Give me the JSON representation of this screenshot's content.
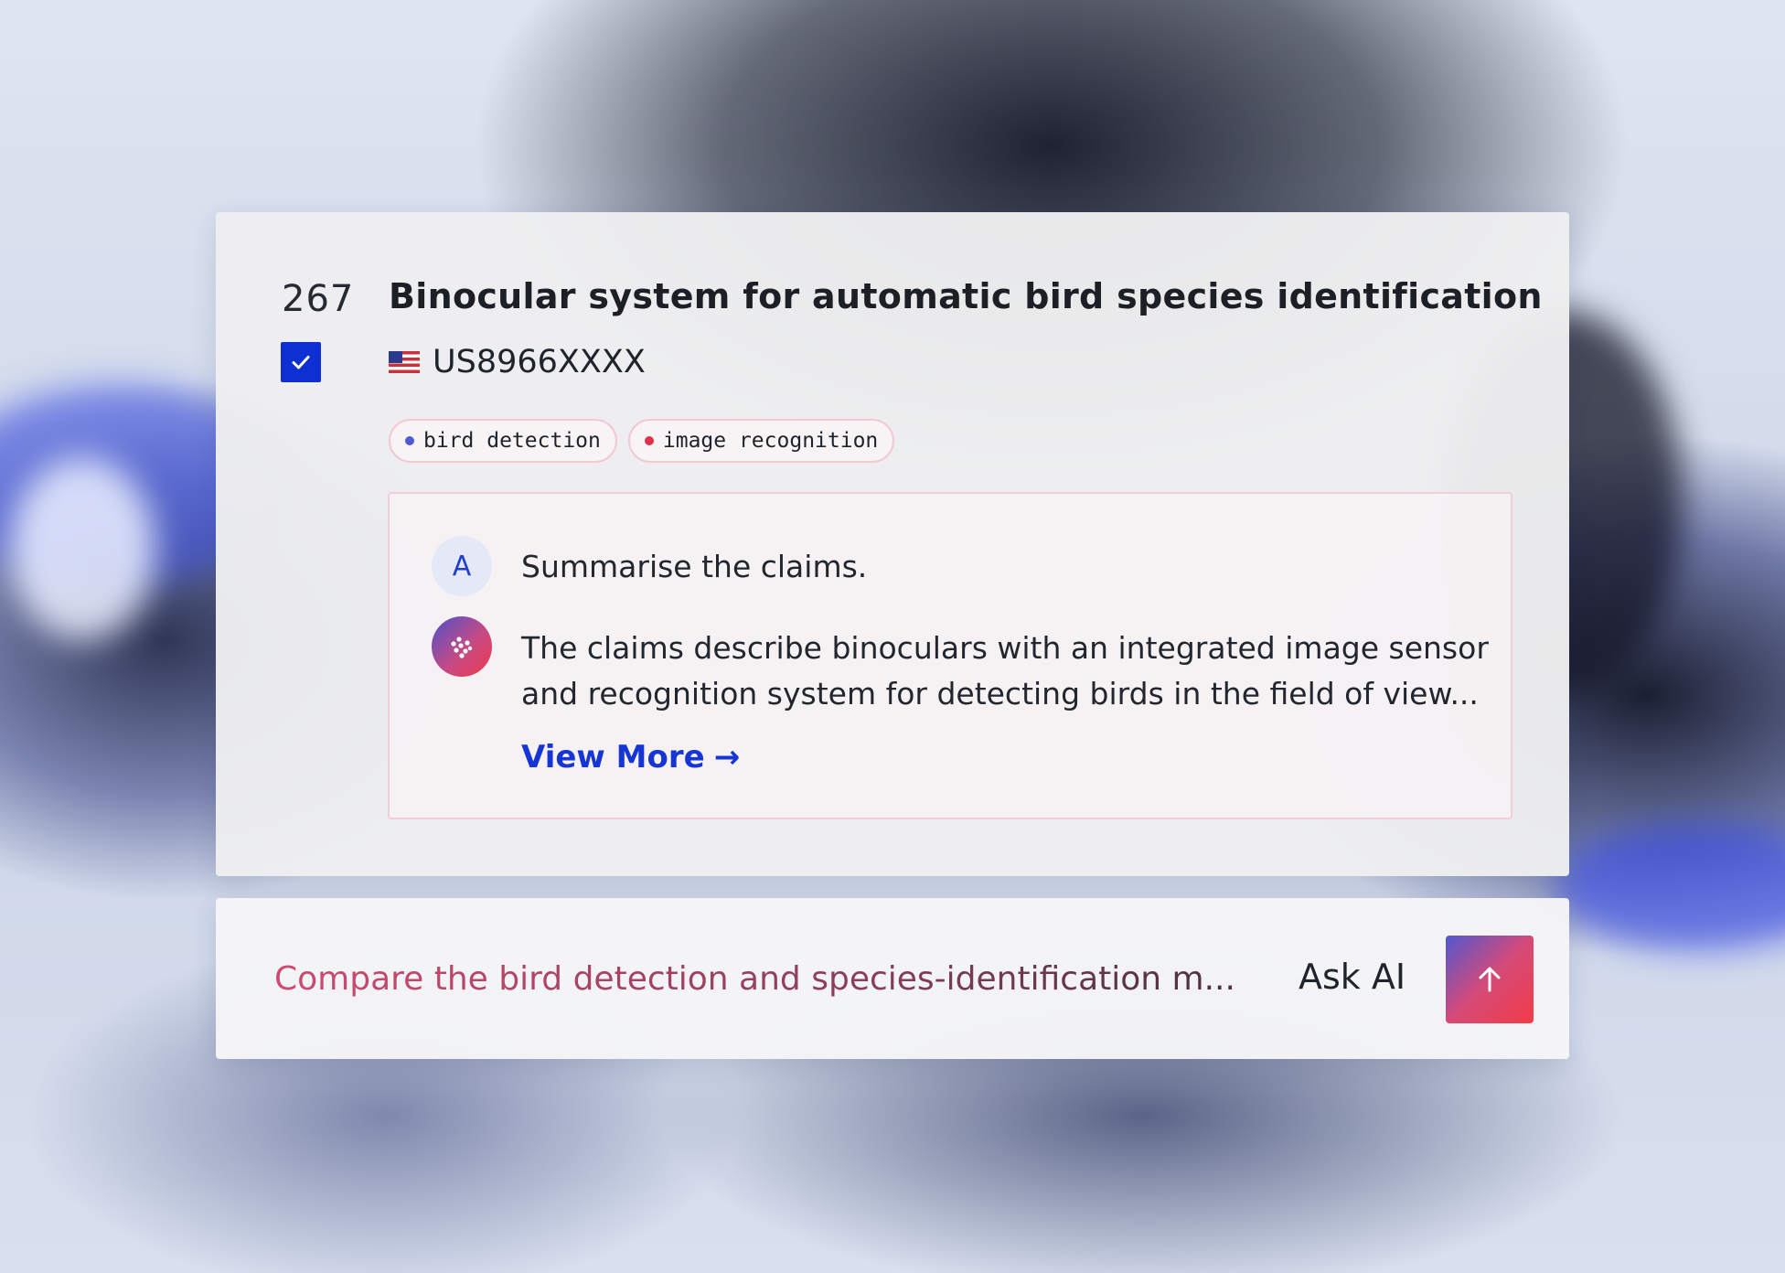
{
  "result": {
    "number": "267",
    "checked": true,
    "title": "Binocular system for automatic bird species identification",
    "patent_id": "US8966XXXX",
    "country_flag": "us-flag-icon"
  },
  "tags": [
    {
      "label": "bird detection",
      "dot_color": "#4f5bd5"
    },
    {
      "label": "image recognition",
      "dot_color": "#e0304a"
    }
  ],
  "chat": {
    "user_initial": "A",
    "question": "Summarise the claims.",
    "answer": "The claims describe binoculars with an integrated image sensor and recognition system for detecting birds in the field of view...",
    "view_more_label": "View More",
    "view_more_arrow": "→"
  },
  "ask_bar": {
    "input_value": "Compare the bird detection and species-identification m...",
    "label": "Ask AI",
    "send_icon": "arrow-up-icon"
  },
  "colors": {
    "accent_blue": "#1535d4",
    "checkbox_blue": "#0e2fd1",
    "gradient_start": "#5059cf",
    "gradient_end": "#f23c48"
  }
}
